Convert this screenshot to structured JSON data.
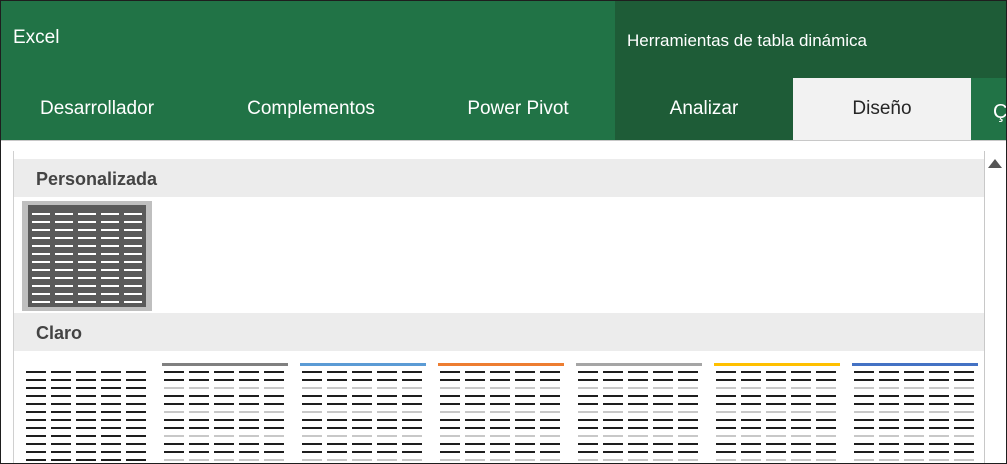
{
  "app": {
    "title": "Excel"
  },
  "context": {
    "title": "Herramientas de tabla dinámica"
  },
  "tabs": [
    {
      "label": "Desarrollador"
    },
    {
      "label": "Complementos"
    },
    {
      "label": "Power Pivot"
    },
    {
      "label": "Analizar"
    },
    {
      "label": "Diseño"
    }
  ],
  "help": {
    "icon": "lightbulb-icon",
    "glyph": "Ç"
  },
  "gallery": {
    "section_custom": "Personalizada",
    "section_light": "Claro"
  },
  "styles": [
    {
      "accent": "#ffffff"
    },
    {
      "accent": "#808080"
    },
    {
      "accent": "#5b9bd5"
    },
    {
      "accent": "#ed7d31"
    },
    {
      "accent": "#a5a5a5"
    },
    {
      "accent": "#ffc000"
    },
    {
      "accent": "#4472c4"
    }
  ],
  "colors": {
    "excel_green": "#217346",
    "context_green": "#1e5c37"
  }
}
